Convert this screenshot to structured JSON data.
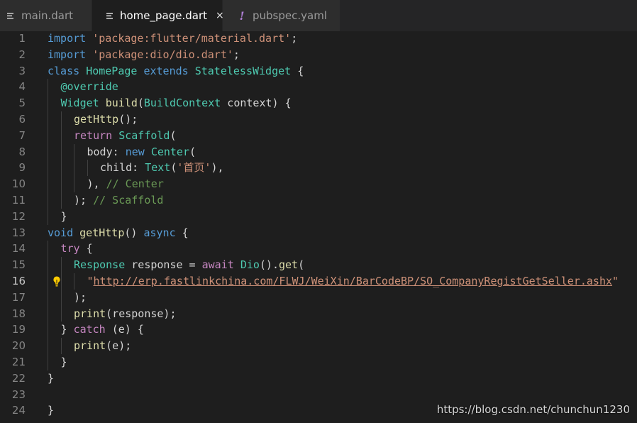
{
  "tabs": [
    {
      "label": "main.dart",
      "icon": "lines-icon",
      "active": false
    },
    {
      "label": "home_page.dart",
      "icon": "lines-icon",
      "active": true,
      "close": "×"
    },
    {
      "label": "pubspec.yaml",
      "icon": "exclamation-icon",
      "active": false,
      "icon_glyph": "!"
    }
  ],
  "colors": {
    "keyword": "#569cd6",
    "control": "#c586c0",
    "string": "#ce9178",
    "type": "#4ec9b0",
    "function": "#dcdcaa",
    "variable": "#9cdcfe",
    "plain": "#d4d4d4",
    "comment": "#6a9955",
    "annotation": "#4ec9b0"
  },
  "editor": {
    "current_line": 16,
    "lines": [
      {
        "n": "1",
        "indent": 0,
        "tokens": [
          [
            "import",
            "keyword"
          ],
          [
            " ",
            "plain"
          ],
          [
            "'package:flutter/material.dart'",
            "string"
          ],
          [
            ";",
            "plain"
          ]
        ]
      },
      {
        "n": "2",
        "indent": 0,
        "tokens": [
          [
            "import",
            "keyword"
          ],
          [
            " ",
            "plain"
          ],
          [
            "'package:dio/dio.dart'",
            "string"
          ],
          [
            ";",
            "plain"
          ]
        ]
      },
      {
        "n": "3",
        "indent": 0,
        "tokens": [
          [
            "class",
            "keyword"
          ],
          [
            " ",
            "plain"
          ],
          [
            "HomePage",
            "type"
          ],
          [
            " ",
            "plain"
          ],
          [
            "extends",
            "keyword"
          ],
          [
            " ",
            "plain"
          ],
          [
            "StatelessWidget",
            "type"
          ],
          [
            " {",
            "plain"
          ]
        ]
      },
      {
        "n": "4",
        "indent": 1,
        "tokens": [
          [
            "@override",
            "annotation"
          ]
        ]
      },
      {
        "n": "5",
        "indent": 1,
        "tokens": [
          [
            "Widget",
            "type"
          ],
          [
            " ",
            "plain"
          ],
          [
            "build",
            "function"
          ],
          [
            "(",
            "plain"
          ],
          [
            "BuildContext",
            "type"
          ],
          [
            " context) {",
            "plain"
          ]
        ]
      },
      {
        "n": "6",
        "indent": 2,
        "tokens": [
          [
            "getHttp",
            "function"
          ],
          [
            "();",
            "plain"
          ]
        ]
      },
      {
        "n": "7",
        "indent": 2,
        "tokens": [
          [
            "return",
            "control"
          ],
          [
            " ",
            "plain"
          ],
          [
            "Scaffold",
            "type"
          ],
          [
            "(",
            "plain"
          ]
        ]
      },
      {
        "n": "8",
        "indent": 3,
        "tokens": [
          [
            "body",
            "plain"
          ],
          [
            ": ",
            "plain"
          ],
          [
            "new",
            "keyword"
          ],
          [
            " ",
            "plain"
          ],
          [
            "Center",
            "type"
          ],
          [
            "(",
            "plain"
          ]
        ]
      },
      {
        "n": "9",
        "indent": 4,
        "tokens": [
          [
            "child",
            "plain"
          ],
          [
            ": ",
            "plain"
          ],
          [
            "Text",
            "type"
          ],
          [
            "(",
            "plain"
          ],
          [
            "'首页'",
            "string"
          ],
          [
            "),",
            "plain"
          ]
        ]
      },
      {
        "n": "10",
        "indent": 3,
        "tokens": [
          [
            "), ",
            "plain"
          ],
          [
            "// Center",
            "comment"
          ]
        ]
      },
      {
        "n": "11",
        "indent": 2,
        "tokens": [
          [
            "); ",
            "plain"
          ],
          [
            "// Scaffold",
            "comment"
          ]
        ]
      },
      {
        "n": "12",
        "indent": 1,
        "tokens": [
          [
            "}",
            "plain"
          ]
        ]
      },
      {
        "n": "13",
        "indent": 0,
        "tokens": [
          [
            "void",
            "keyword"
          ],
          [
            " ",
            "plain"
          ],
          [
            "getHttp",
            "function"
          ],
          [
            "() ",
            "plain"
          ],
          [
            "async",
            "keyword"
          ],
          [
            " {",
            "plain"
          ]
        ]
      },
      {
        "n": "14",
        "indent": 1,
        "tokens": [
          [
            "try",
            "control"
          ],
          [
            " {",
            "plain"
          ]
        ]
      },
      {
        "n": "15",
        "indent": 2,
        "tokens": [
          [
            "Response",
            "type"
          ],
          [
            " response = ",
            "plain"
          ],
          [
            "await",
            "control"
          ],
          [
            " ",
            "plain"
          ],
          [
            "Dio",
            "type"
          ],
          [
            "().",
            "plain"
          ],
          [
            "get",
            "function"
          ],
          [
            "(",
            "plain"
          ]
        ]
      },
      {
        "n": "16",
        "indent": 3,
        "tokens": [
          [
            "\"",
            "string"
          ],
          [
            "http://erp.fastlinkchina.com/FLWJ/WeiXin/BarCodeBP/SO_CompanyRegistGetSeller.ashx",
            "string-url"
          ],
          [
            "\"",
            "string"
          ]
        ]
      },
      {
        "n": "17",
        "indent": 2,
        "tokens": [
          [
            ");",
            "plain"
          ]
        ]
      },
      {
        "n": "18",
        "indent": 2,
        "tokens": [
          [
            "print",
            "function"
          ],
          [
            "(response);",
            "plain"
          ]
        ]
      },
      {
        "n": "19",
        "indent": 1,
        "tokens": [
          [
            "} ",
            "plain"
          ],
          [
            "catch",
            "control"
          ],
          [
            " (e) {",
            "plain"
          ]
        ]
      },
      {
        "n": "20",
        "indent": 2,
        "tokens": [
          [
            "print",
            "function"
          ],
          [
            "(e);",
            "plain"
          ]
        ]
      },
      {
        "n": "21",
        "indent": 1,
        "tokens": [
          [
            "}",
            "plain"
          ]
        ]
      },
      {
        "n": "22",
        "indent": 0,
        "tokens": [
          [
            "}",
            "plain"
          ]
        ]
      },
      {
        "n": "23",
        "indent": 0,
        "tokens": []
      },
      {
        "n": "24",
        "indent": 0,
        "tokens": [
          [
            "}",
            "plain"
          ]
        ]
      }
    ]
  },
  "lightbulb_icon": "lightbulb-icon",
  "watermark": "https://blog.csdn.net/chunchun1230"
}
